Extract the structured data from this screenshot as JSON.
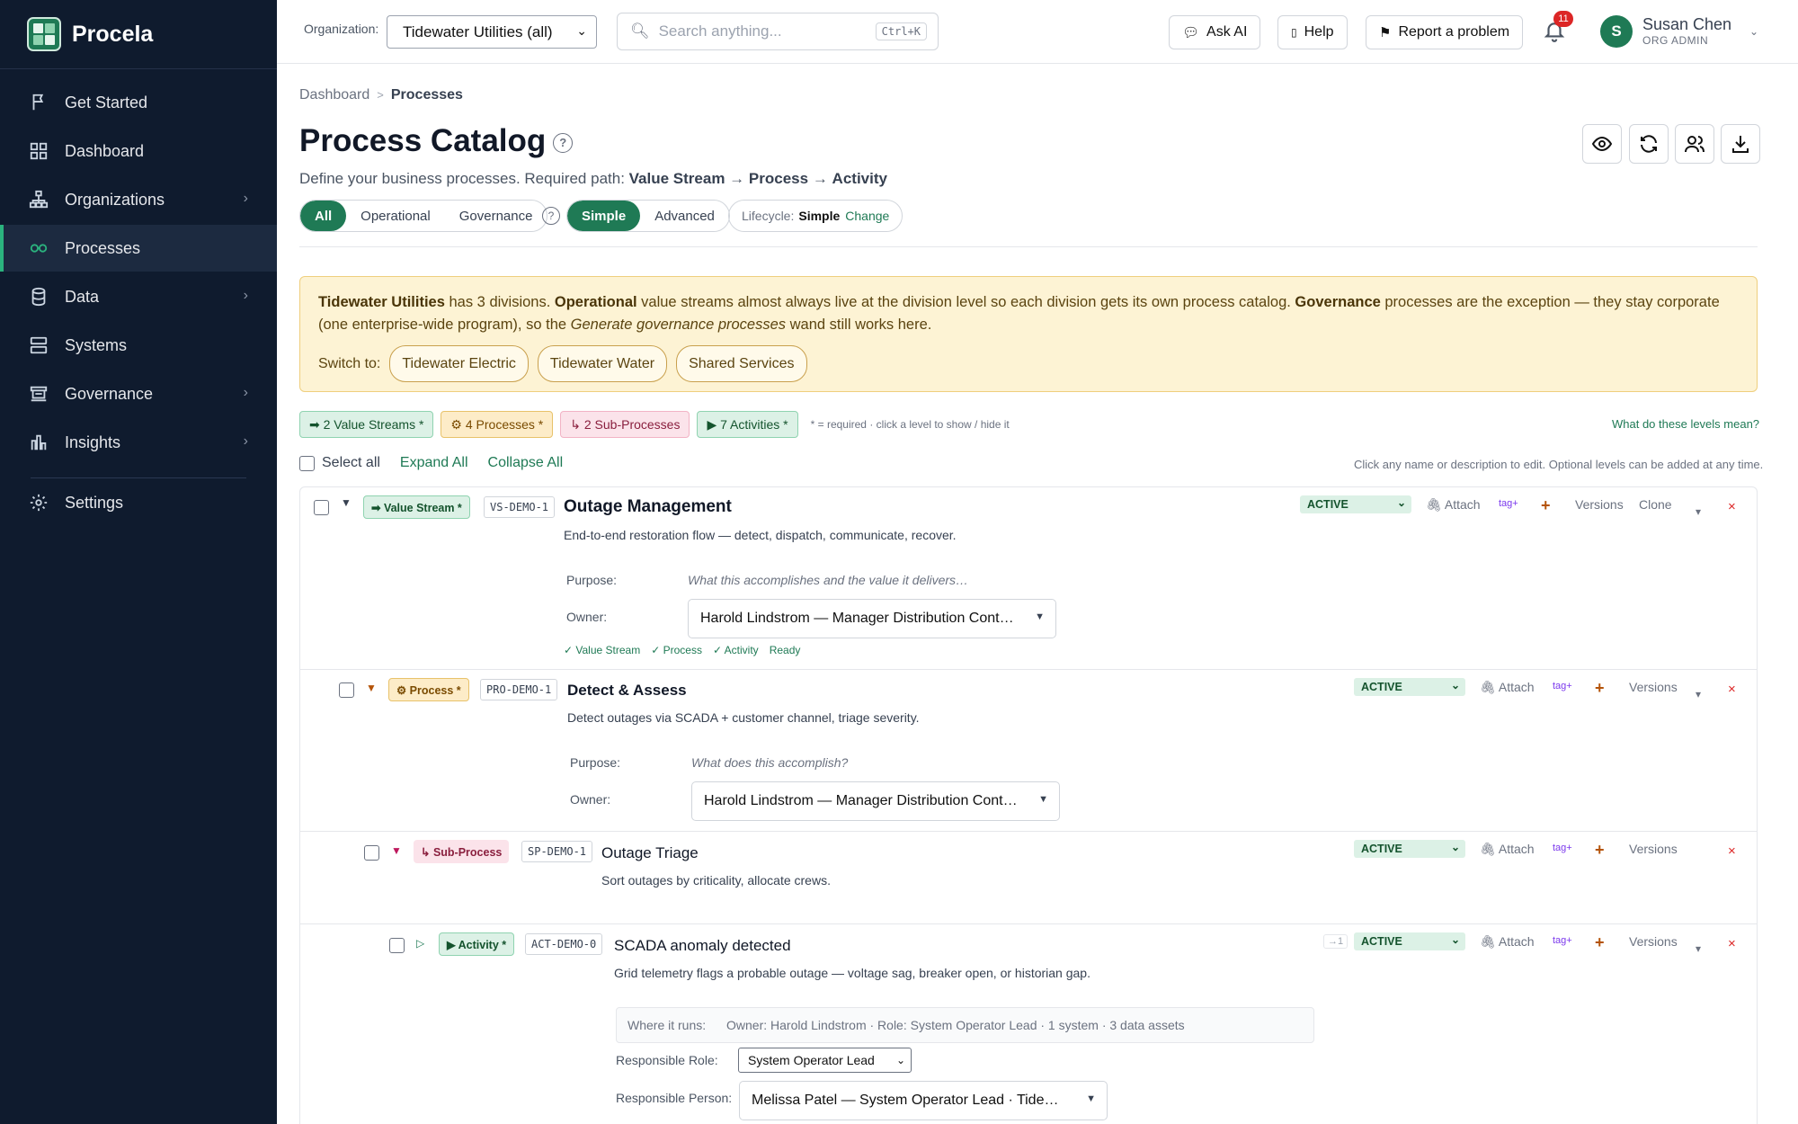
{
  "brand": {
    "name": "Procela"
  },
  "nav": [
    {
      "label": "Get Started",
      "icon": "flag-icon",
      "chevron": false
    },
    {
      "label": "Dashboard",
      "icon": "grid-icon",
      "chevron": false
    },
    {
      "label": "Organizations",
      "icon": "org-chart-icon",
      "chevron": true
    },
    {
      "label": "Processes",
      "icon": "infinity-icon",
      "chevron": false,
      "active": true
    },
    {
      "label": "Data",
      "icon": "database-icon",
      "chevron": true
    },
    {
      "label": "Systems",
      "icon": "server-icon",
      "chevron": false
    },
    {
      "label": "Governance",
      "icon": "governance-icon",
      "chevron": true
    },
    {
      "label": "Insights",
      "icon": "bar-chart-icon",
      "chevron": true
    },
    {
      "label": "Settings",
      "icon": "gear-icon",
      "chevron": false
    }
  ],
  "topbar": {
    "org_label": "Organization:",
    "org_value": "Tidewater Utilities (all)",
    "search_placeholder": "Search anything...",
    "search_kbd": "Ctrl+K",
    "ask_ai": "Ask AI",
    "help": "Help",
    "report": "Report a problem",
    "notif_count": "11",
    "user_initial": "S",
    "user_name": "Susan Chen",
    "user_role": "ORG ADMIN"
  },
  "breadcrumb": {
    "root": "Dashboard",
    "sep": ">",
    "current": "Processes"
  },
  "page": {
    "title": "Process Catalog",
    "help": "?",
    "desc_prefix": "Define your business processes. Required path: ",
    "path_vs": "Value Stream",
    "arrow": "→",
    "path_p": "Process",
    "path_a": "Activity"
  },
  "filters": {
    "all": "All",
    "operational": "Operational",
    "governance": "Governance",
    "help": "?",
    "simple": "Simple",
    "advanced": "Advanced",
    "lifecycle_label": "Lifecycle:",
    "lifecycle_value": "Simple",
    "lifecycle_change": "Change"
  },
  "banner": {
    "org": "Tidewater Utilities",
    "t1": " has 3 divisions. ",
    "op": "Operational",
    "t2": " value streams almost always live at the division level so each division gets its own process catalog. ",
    "gov": "Governance",
    "t3": " processes are the exception — they stay corporate (one enterprise-wide program), so the ",
    "wand": "Generate governance processes",
    "t4": " wand still works here.",
    "switch_label": "Switch to:",
    "pills": [
      "Tidewater Electric",
      "Tidewater Water",
      "Shared Services"
    ]
  },
  "chips": {
    "vs": "➡ 2 Value Streams *",
    "p": "⚙ 4 Processes *",
    "sp": "↳ 2 Sub-Processes",
    "a": "▶ 7 Activities *",
    "note": "* = required · click a level to show / hide it",
    "levels_link": "What do these levels mean?"
  },
  "toolbar": {
    "select_all": "Select all",
    "expand": "Expand All",
    "collapse": "Collapse All",
    "hint": "Click any name or description to edit. Optional levels can be added at any time."
  },
  "rows": [
    {
      "badge": "➡ Value Stream *",
      "code": "VS-DEMO-1",
      "name": "Outage Management",
      "desc": "End-to-end restoration flow — detect, dispatch, communicate, recover.",
      "status": "ACTIVE",
      "attach": "Attach",
      "tag": "tag+",
      "plus": "+",
      "versions": "Versions",
      "clone": "Clone",
      "dn": "▾",
      "x": "×",
      "purpose_label": "Purpose:",
      "purpose": "What this accomplishes and the value it delivers…",
      "owner_label": "Owner:",
      "owner": "Harold Lindstrom — Manager Distribution Cont…",
      "checks": [
        "✓ Value Stream",
        "✓ Process",
        "✓ Activity",
        "Ready"
      ]
    },
    {
      "badge": "⚙ Process *",
      "code": "PRO-DEMO-1",
      "name": "Detect & Assess",
      "desc": "Detect outages via SCADA + customer channel, triage severity.",
      "status": "ACTIVE",
      "attach": "Attach",
      "tag": "tag+",
      "plus": "+",
      "versions": "Versions",
      "dn": "▾",
      "x": "×",
      "purpose_label": "Purpose:",
      "purpose": "What does this accomplish?",
      "owner_label": "Owner:",
      "owner": "Harold Lindstrom — Manager Distribution Cont…"
    },
    {
      "badge": "↳ Sub-Process",
      "code": "SP-DEMO-1",
      "name": "Outage Triage",
      "desc": "Sort outages by criticality, allocate crews.",
      "status": "ACTIVE",
      "attach": "Attach",
      "tag": "tag+",
      "plus": "+",
      "versions": "Versions",
      "x": "×"
    },
    {
      "badge": "▶ Activity *",
      "code": "ACT-DEMO-0",
      "name": "SCADA anomaly detected",
      "desc": "Grid telemetry flags a probable outage — voltage sag, breaker open, or historian gap.",
      "dep": "→1",
      "status": "ACTIVE",
      "attach": "Attach",
      "tag": "tag+",
      "plus": "+",
      "versions": "Versions",
      "dn": "▾",
      "x": "×",
      "where_label": "Where it runs:",
      "where": "Owner: Harold Lindstrom · Role: System Operator Lead · 1 system · 3 data assets",
      "role_label": "Responsible Role:",
      "role": "System Operator Lead",
      "person_label": "Responsible Person:",
      "person": "Melissa Patel — System Operator Lead · Tide…"
    }
  ]
}
